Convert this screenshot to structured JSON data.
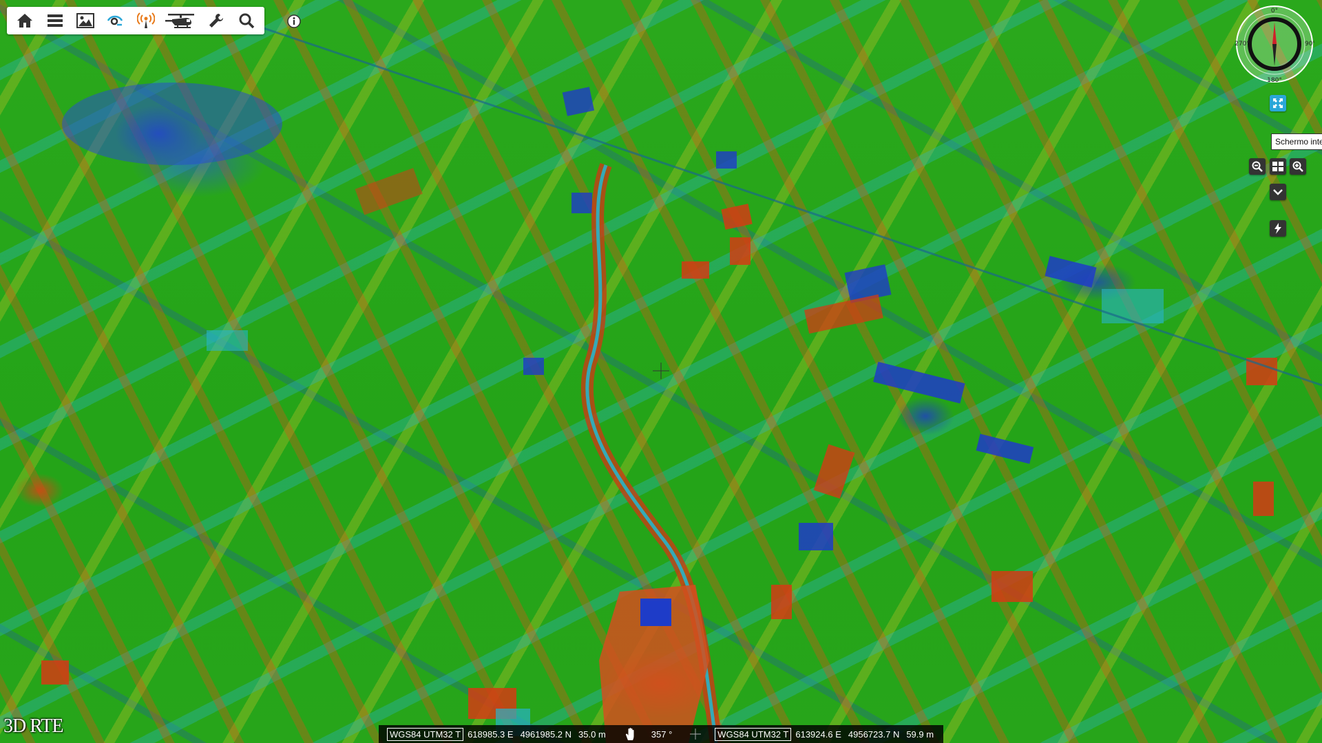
{
  "app": {
    "brand": "3D RTE"
  },
  "toolbar": {
    "items": [
      {
        "name": "home",
        "icon": "home-icon"
      },
      {
        "name": "menu",
        "icon": "menu-icon"
      },
      {
        "name": "image",
        "icon": "image-icon"
      },
      {
        "name": "eye",
        "icon": "eye-icon"
      },
      {
        "name": "signal",
        "icon": "signal-icon"
      },
      {
        "name": "helicopter",
        "icon": "helicopter-icon"
      },
      {
        "name": "tools",
        "icon": "wrench-icon"
      },
      {
        "name": "search",
        "icon": "search-icon"
      }
    ]
  },
  "compass": {
    "north": "0°",
    "east": "90°",
    "south": "180°",
    "west": "270°"
  },
  "controls": {
    "tooltip": "Schermo intero"
  },
  "status": {
    "left": {
      "crs": "WGS84 UTM32 T",
      "easting": "618985.3 E",
      "northing": "4961985.2 N",
      "elevation": "35.0 m"
    },
    "heading": "357 °",
    "right": {
      "crs": "WGS84 UTM32 T",
      "easting": "613924.6 E",
      "northing": "4956723.7 N",
      "elevation": "59.9 m"
    }
  },
  "colors": {
    "accent": "#2aa7d8",
    "toolbar_icon": "#333333",
    "map_green": "#27a51a",
    "map_red": "#d23c14",
    "map_blue": "#1e3cc8",
    "map_cyan": "#28b4c8",
    "map_yellow": "#e6c828"
  }
}
